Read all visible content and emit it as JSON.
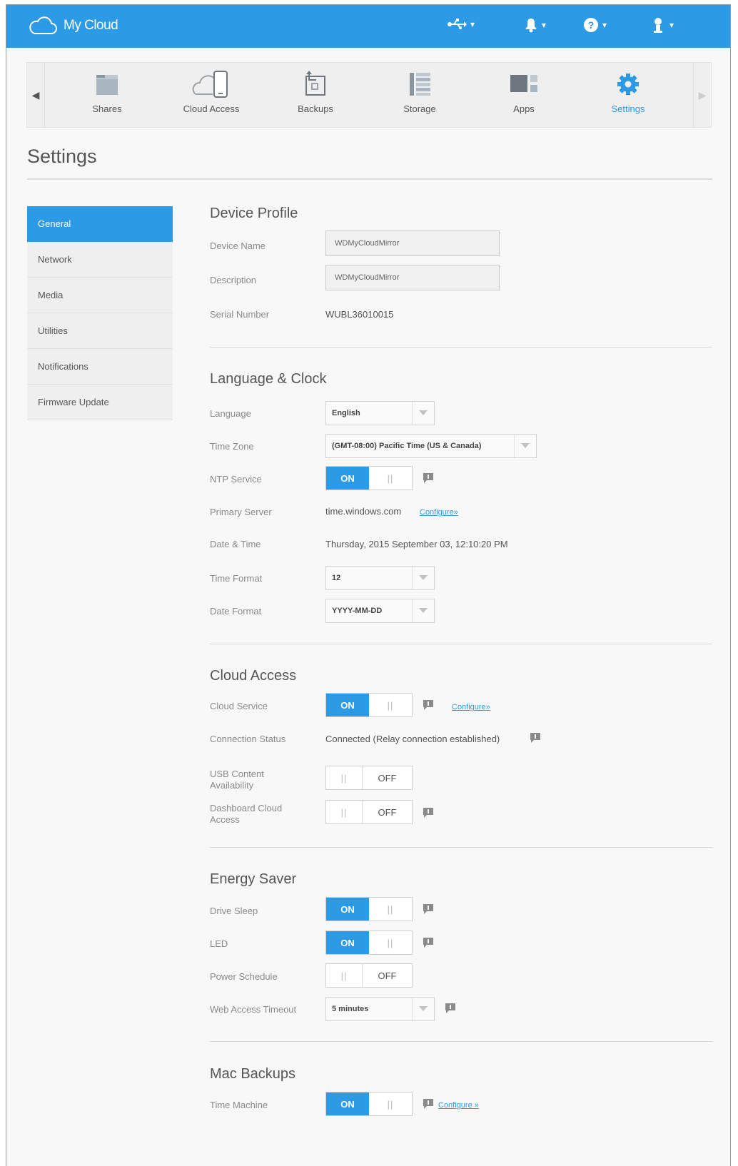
{
  "header": {
    "app_name": "My Cloud",
    "icons": [
      "usb-icon",
      "bell-icon",
      "help-icon",
      "user-icon"
    ]
  },
  "nav": {
    "items": [
      {
        "label": "Shares",
        "icon": "shares-icon"
      },
      {
        "label": "Cloud Access",
        "icon": "cloud-access-icon"
      },
      {
        "label": "Backups",
        "icon": "backups-icon"
      },
      {
        "label": "Storage",
        "icon": "storage-icon"
      },
      {
        "label": "Apps",
        "icon": "apps-icon"
      },
      {
        "label": "Settings",
        "icon": "settings-icon",
        "active": true
      }
    ]
  },
  "page": {
    "title": "Settings"
  },
  "sidebar": {
    "items": [
      {
        "label": "General",
        "active": true
      },
      {
        "label": "Network"
      },
      {
        "label": "Media"
      },
      {
        "label": "Utilities"
      },
      {
        "label": "Notifications"
      },
      {
        "label": "Firmware Update"
      }
    ]
  },
  "device_profile": {
    "title": "Device Profile",
    "device_name_label": "Device Name",
    "device_name_value": "WDMyCloudMirror",
    "description_label": "Description",
    "description_value": "WDMyCloudMirror",
    "serial_label": "Serial Number",
    "serial_value": "WUBL36010015"
  },
  "language_clock": {
    "title": "Language & Clock",
    "language_label": "Language",
    "language_value": "English",
    "timezone_label": "Time Zone",
    "timezone_value": "(GMT-08:00) Pacific Time (US & Canada)",
    "ntp_label": "NTP Service",
    "ntp_on": "ON",
    "primary_server_label": "Primary Server",
    "primary_server_value": "time.windows.com",
    "primary_server_link": "Configure»",
    "datetime_label": "Date & Time",
    "datetime_value": "Thursday, 2015 September 03, 12:10:20 PM",
    "time_format_label": "Time Format",
    "time_format_value": "12",
    "date_format_label": "Date Format",
    "date_format_value": "YYYY-MM-DD"
  },
  "cloud_access": {
    "title": "Cloud Access",
    "cloud_service_label": "Cloud Service",
    "cloud_service_on": "ON",
    "cloud_service_link": "Configure»",
    "connection_status_label": "Connection Status",
    "connection_status_value": "Connected (Relay connection established)",
    "usb_content_label": "USB Content Availability",
    "usb_content_off": "OFF",
    "dashboard_cloud_label": "Dashboard Cloud Access",
    "dashboard_cloud_off": "OFF"
  },
  "energy_saver": {
    "title": "Energy Saver",
    "drive_sleep_label": "Drive Sleep",
    "drive_sleep_on": "ON",
    "led_label": "LED",
    "led_on": "ON",
    "power_schedule_label": "Power Schedule",
    "power_schedule_off": "OFF",
    "web_timeout_label": "Web Access Timeout",
    "web_timeout_value": "5 minutes"
  },
  "mac_backups": {
    "title": "Mac Backups",
    "time_machine_label": "Time Machine",
    "time_machine_on": "ON",
    "time_machine_link": "Configure »"
  },
  "colors": {
    "accent": "#2d9ae6",
    "panel": "#efefef"
  }
}
